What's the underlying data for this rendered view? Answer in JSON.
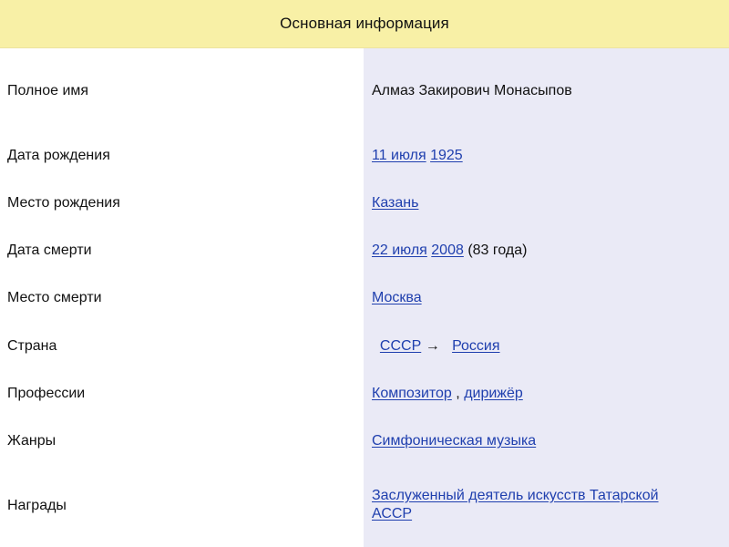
{
  "header": {
    "title": "Основная информация"
  },
  "colors": {
    "header_bg": "#f8f0a6",
    "value_bg": "#eaeaf6",
    "link": "#1f3fae"
  },
  "rows": [
    {
      "label": "Полное имя",
      "value": "Алмаз Закирович Монасыпов"
    },
    {
      "label": "Дата рождения",
      "link1": "11 июля",
      "link2": "1925"
    },
    {
      "label": "Место рождения",
      "link1": "Казань"
    },
    {
      "label": "Дата смерти",
      "link1": "22 июля",
      "link2": "2008",
      "suffix": "(83 года)"
    },
    {
      "label": "Место смерти",
      "link1": "Москва"
    },
    {
      "label": "Страна",
      "link1": "СССР",
      "arrow": "→",
      "link2": "Россия"
    },
    {
      "label": "Профессии",
      "link1": "Композитор",
      "separator": ",",
      "link2": "дирижёр"
    },
    {
      "label": "Жанры",
      "link1": "Симфоническая музыка"
    },
    {
      "label": "Награды",
      "link1_line1": "Заслуженный деятель искусств Татарской",
      "link1_line2": "АССР"
    }
  ]
}
